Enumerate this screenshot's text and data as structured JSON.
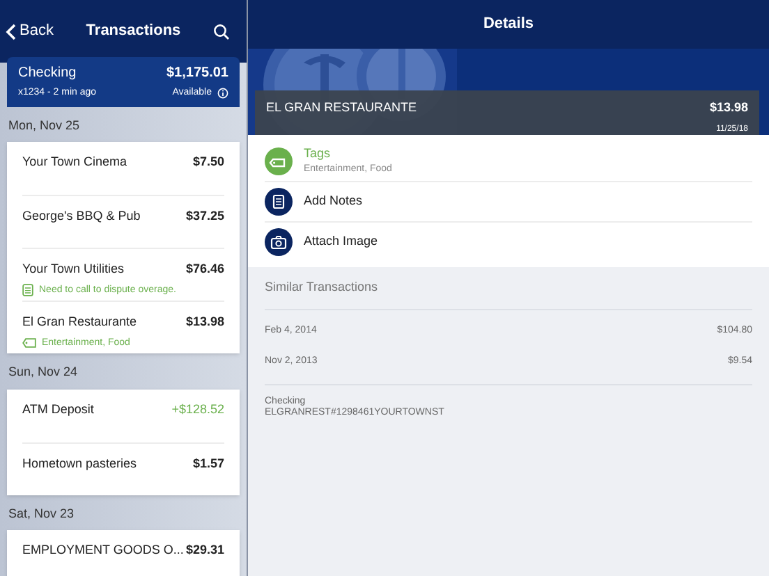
{
  "sidebar": {
    "back": "Back",
    "title": "Transactions",
    "account": {
      "name": "Checking",
      "balance": "$1,175.01",
      "meta": "x1234 - 2 min ago",
      "available": "Available"
    },
    "groups": [
      {
        "date": "Mon, Nov 25",
        "transactions": [
          {
            "name": "Your Town Cinema",
            "amount": "$7.50",
            "credit": false
          },
          {
            "name": "George's BBQ & Pub",
            "amount": "$37.25",
            "credit": false
          },
          {
            "name": "Your Town Utilities",
            "amount": "$76.46",
            "credit": false,
            "note": {
              "kind": "note",
              "text": "Need to call to dispute overage."
            }
          },
          {
            "name": "El Gran Restaurante",
            "amount": "$13.98",
            "credit": false,
            "note": {
              "kind": "tags",
              "text": "Entertainment, Food"
            }
          }
        ]
      },
      {
        "date": "Sun, Nov 24",
        "transactions": [
          {
            "name": "ATM Deposit",
            "amount": "+$128.52",
            "credit": true
          },
          {
            "name": "Hometown pasteries",
            "amount": "$1.57",
            "credit": false
          }
        ]
      },
      {
        "date": "Sat, Nov 23",
        "transactions": [
          {
            "name": "EMPLOYMENT GOODS O...",
            "amount": "$29.31",
            "credit": false
          }
        ]
      }
    ]
  },
  "details": {
    "title": "Details",
    "merchant": "EL GRAN RESTAURANTE",
    "amount": "$13.98",
    "date": "11/25/18",
    "actions": [
      {
        "kind": "tags",
        "label": "Tags",
        "sub": "Entertainment, Food"
      },
      {
        "kind": "notes",
        "label": "Add Notes"
      },
      {
        "kind": "camera",
        "label": "Attach Image"
      }
    ],
    "similar_title": "Similar Transactions",
    "similar": [
      {
        "date": "Feb 4, 2014",
        "amount": "$104.80"
      },
      {
        "date": "Nov 2, 2013",
        "amount": "$9.54"
      }
    ],
    "account": "Checking",
    "description": "ELGRANREST#1298461YOURTOWNST"
  }
}
